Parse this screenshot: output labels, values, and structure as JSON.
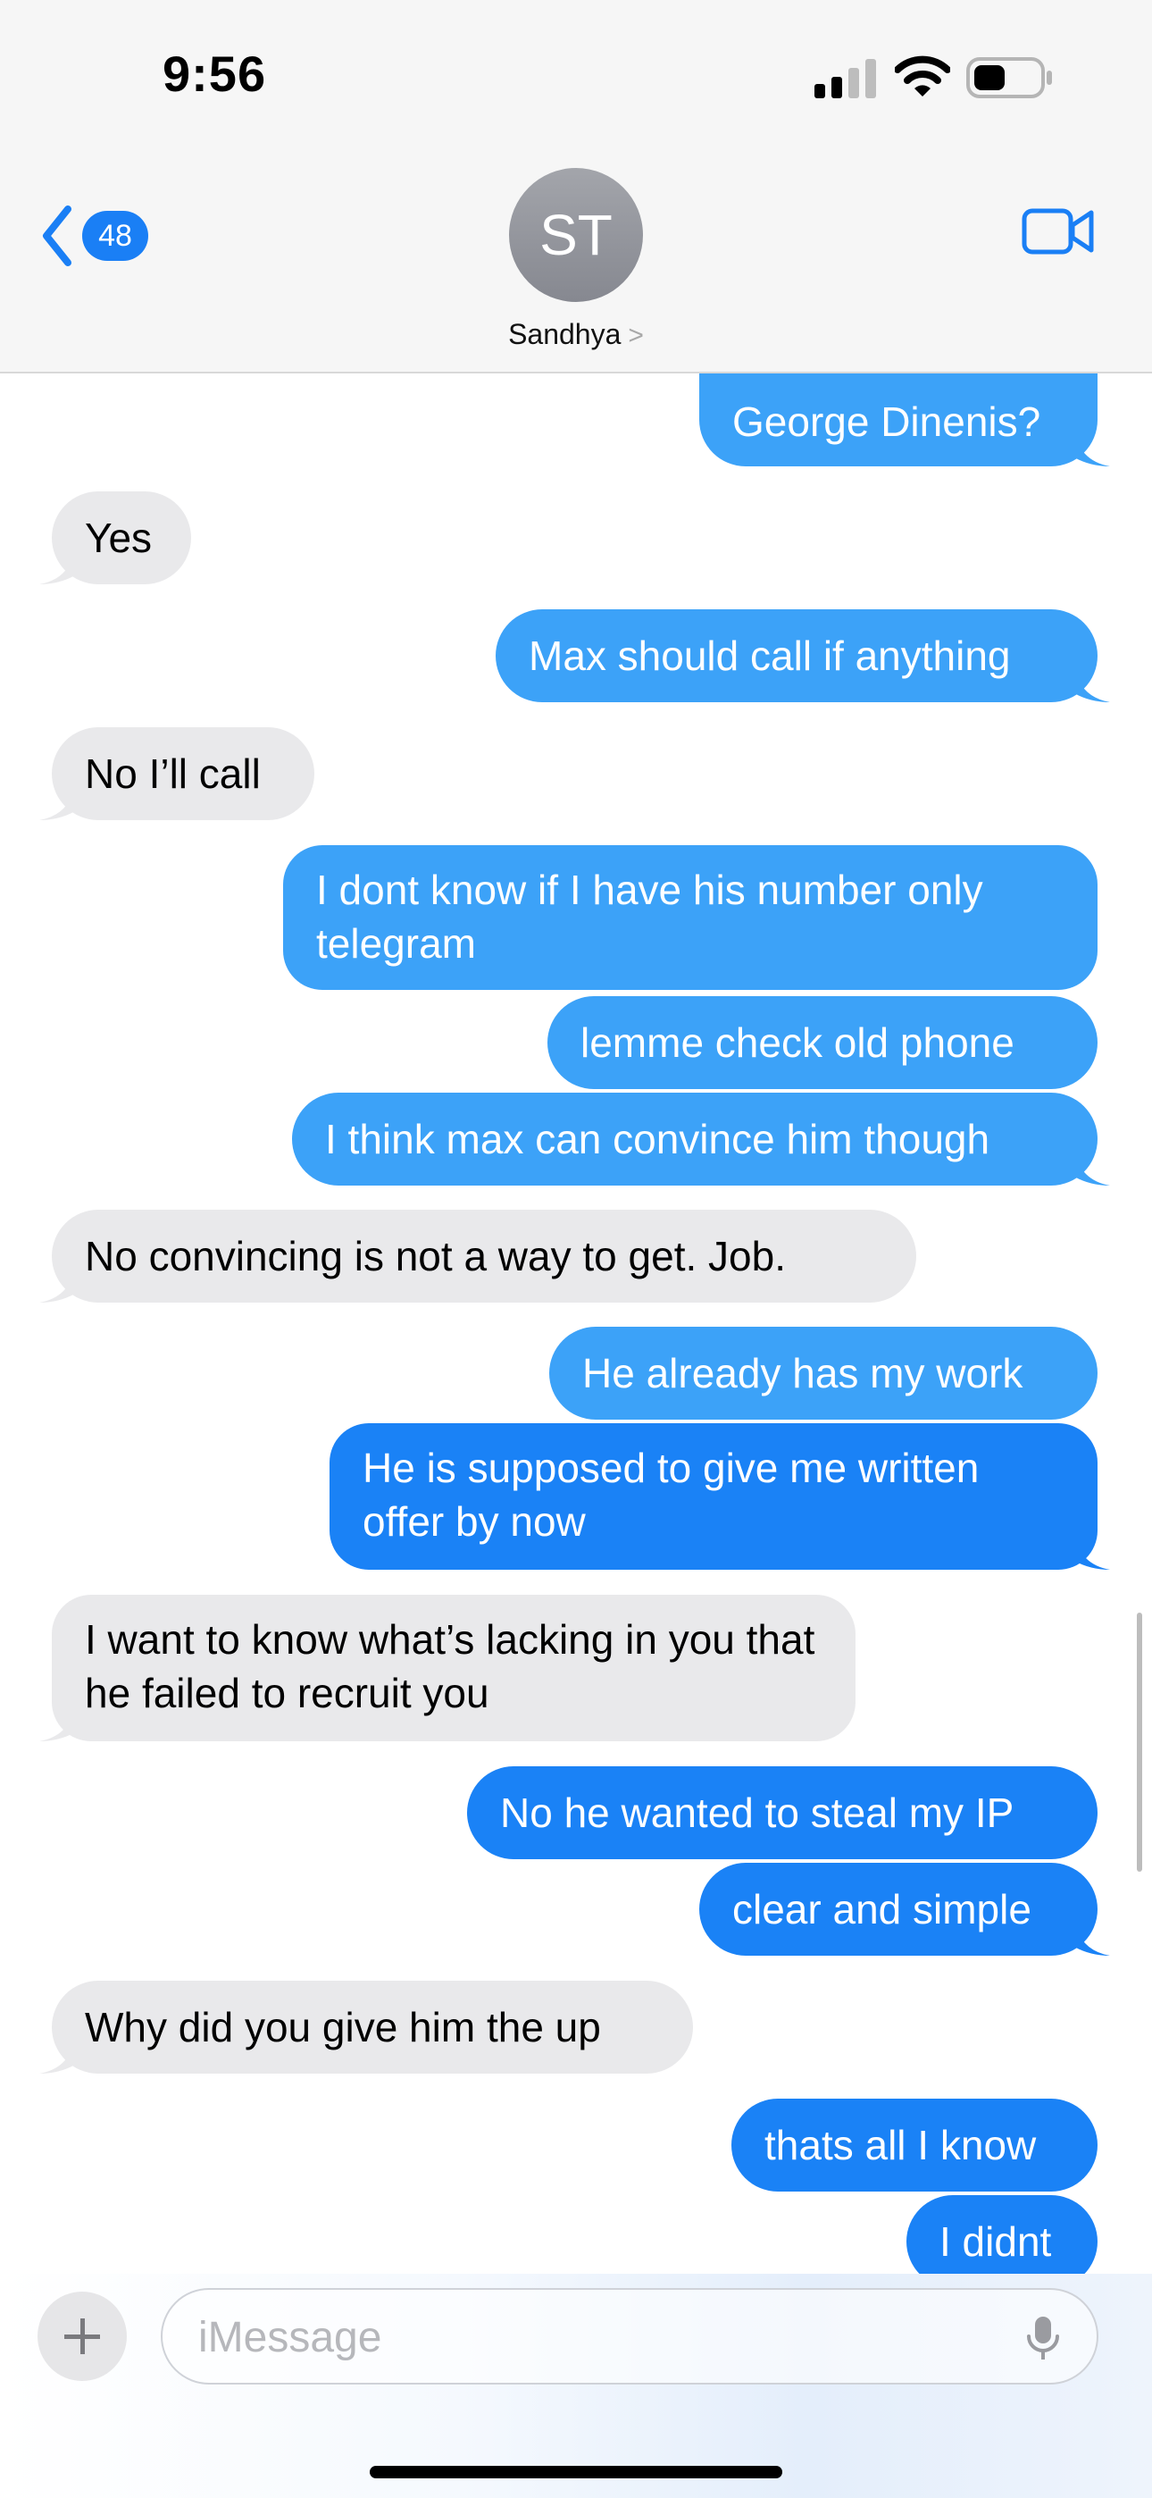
{
  "status_bar": {
    "time": "9:56"
  },
  "header": {
    "back_badge": "48",
    "avatar_initials": "ST",
    "contact_name": "Sandhya",
    "contact_chevron": ">"
  },
  "messages": [
    {
      "from": "me",
      "text": "George Dinenis?"
    },
    {
      "from": "them",
      "text": "Yes"
    },
    {
      "from": "me",
      "text": "Max should call if anything"
    },
    {
      "from": "them",
      "text": "No I’ll call"
    },
    {
      "from": "me",
      "text": "I dont know if I have his number only telegram"
    },
    {
      "from": "me",
      "text": "lemme check old phone"
    },
    {
      "from": "me",
      "text": "I think max can convince him though"
    },
    {
      "from": "them",
      "text": "No convincing is not a way to get. Job."
    },
    {
      "from": "me",
      "text": "He already has my work"
    },
    {
      "from": "me",
      "text": "He is supposed to give me written offer by now"
    },
    {
      "from": "them",
      "text": "I want to know what’s lacking in you that he failed to recruit you"
    },
    {
      "from": "me",
      "text": "No he wanted to steal my IP"
    },
    {
      "from": "me",
      "text": "clear and simple"
    },
    {
      "from": "them",
      "text": "Why did you give him the up"
    },
    {
      "from": "me",
      "text": "thats all I know"
    },
    {
      "from": "me",
      "text": "I didnt"
    }
  ],
  "composer": {
    "placeholder": "iMessage"
  },
  "colors": {
    "sent_bubble": "#1a82f6",
    "sent_bubble_top": "#3ca2f8",
    "received_bubble": "#e9e9eb",
    "accent": "#1a7ff5"
  }
}
